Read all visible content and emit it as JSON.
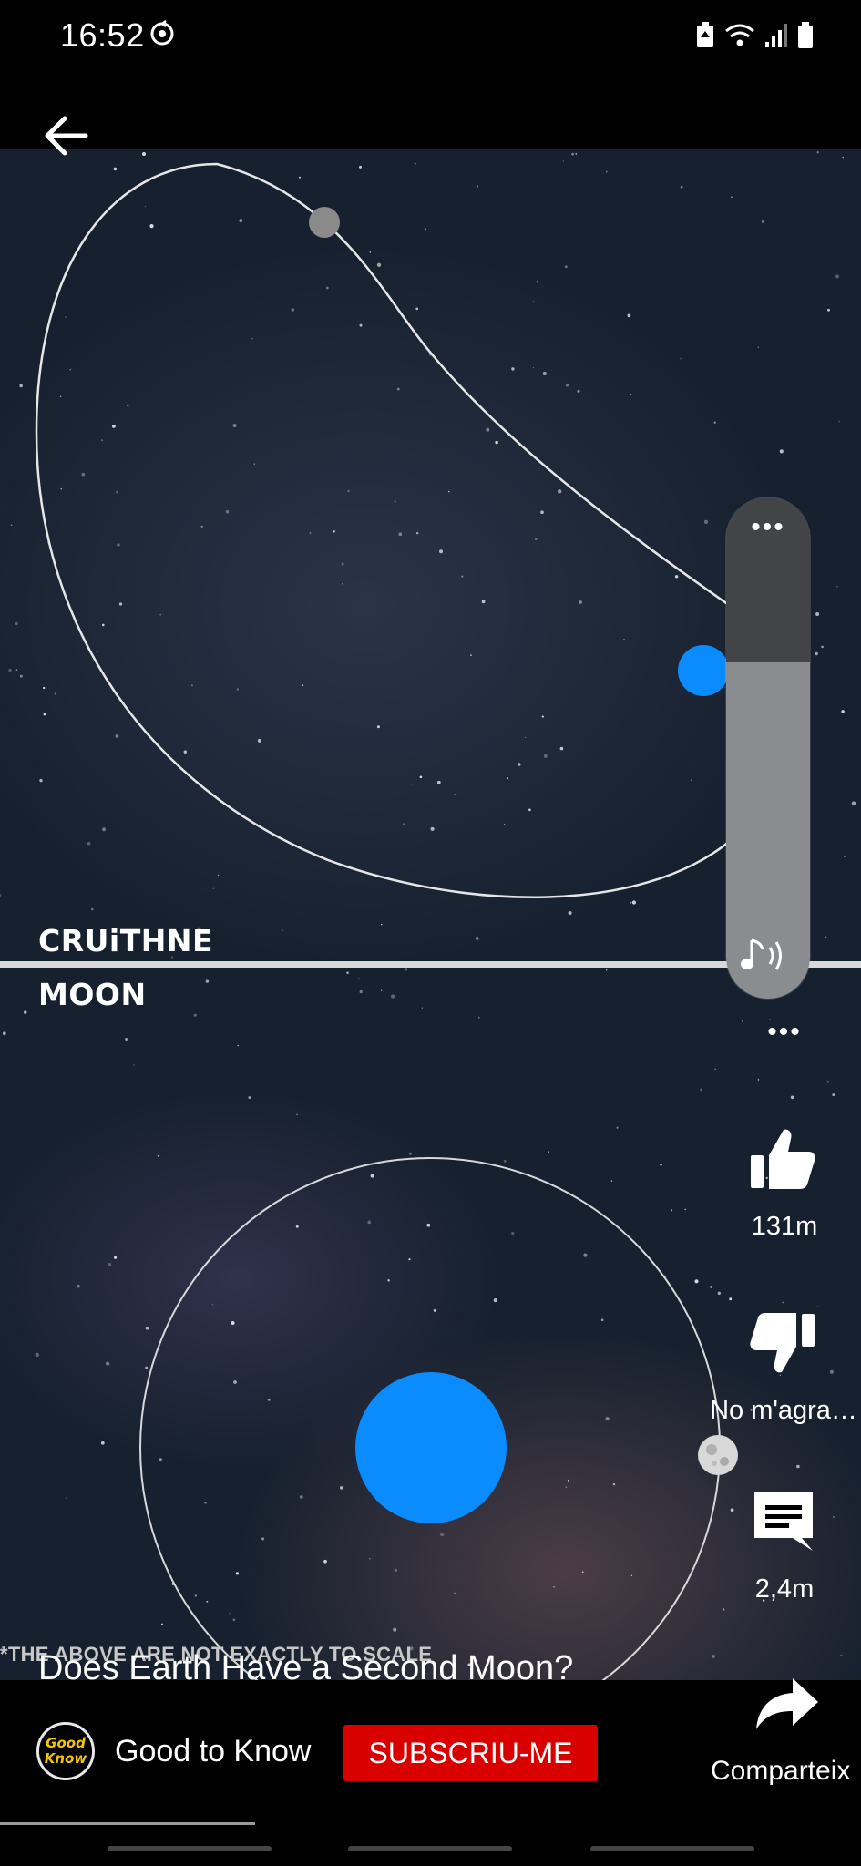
{
  "status_bar": {
    "time": "16:52"
  },
  "video": {
    "label_top": "CRUiTHNE",
    "label_bottom": "MOON",
    "scale_note": "*THE ABOVE ARE NOT EXACTLY TO SCALE",
    "title": "Does Earth Have a Second Moon?",
    "earth_color": "#0a8cff"
  },
  "volume": {
    "menu_label": "•••",
    "level": 0.67
  },
  "actions": {
    "more_label": "•••",
    "like_count": "131m",
    "dislike_label": "No m'agra…",
    "comment_count": "2,4m",
    "share_label": "Comparteix"
  },
  "channel": {
    "name": "Good to Know",
    "avatar_text_1": "Good",
    "avatar_text_2": "Know",
    "subscribe_label": "SUBSCRIU-ME"
  },
  "colors": {
    "subscribe": "#d90000",
    "accent_blue": "#0a8cff"
  }
}
